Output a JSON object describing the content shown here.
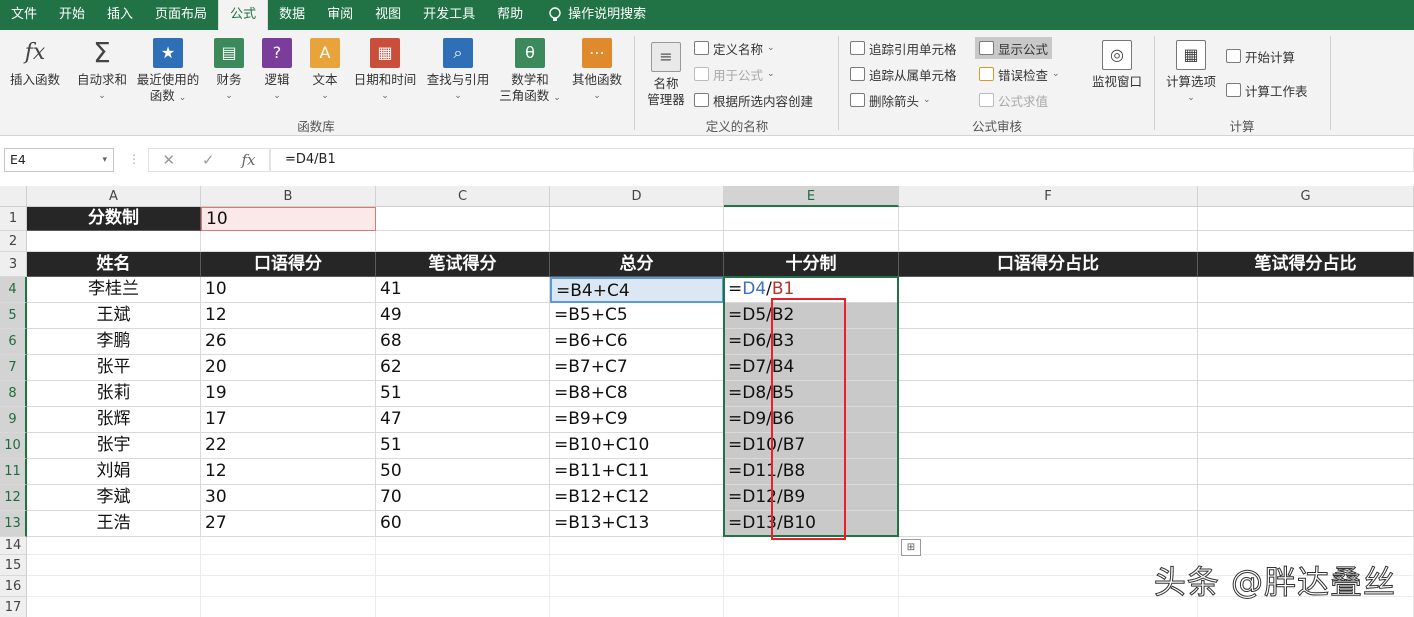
{
  "menu": {
    "tabs": [
      "文件",
      "开始",
      "插入",
      "页面布局",
      "公式",
      "数据",
      "审阅",
      "视图",
      "开发工具",
      "帮助"
    ],
    "active_tab": "公式",
    "tell_me": "操作说明搜索"
  },
  "ribbon": {
    "insert_function": "插入函数",
    "autosum": "自动求和",
    "recent": "最近使用的",
    "recent2": "函数",
    "financial": "财务",
    "logical": "逻辑",
    "text": "文本",
    "datetime": "日期和时间",
    "lookup": "查找与引用",
    "math": "数学和",
    "math2": "三角函数",
    "more": "其他函数",
    "library_label": "函数库",
    "name_manager": "名称",
    "name_manager2": "管理器",
    "define_name": "定义名称",
    "use_in_formula": "用于公式",
    "create_from_selection": "根据所选内容创建",
    "names_label": "定义的名称",
    "trace_precedents": "追踪引用单元格",
    "trace_dependents": "追踪从属单元格",
    "remove_arrows": "删除箭头",
    "show_formulas": "显示公式",
    "error_checking": "错误检查",
    "evaluate_formula": "公式求值",
    "watch_window": "监视窗口",
    "auditing_label": "公式审核",
    "calc_options": "计算选项",
    "calc_now": "开始计算",
    "calc_sheet": "计算工作表",
    "calc_label": "计算"
  },
  "formula_bar": {
    "name_box": "E4",
    "cancel": "✕",
    "enter": "✓",
    "fx": "fx",
    "formula": "=D4/B1"
  },
  "columns": [
    "A",
    "B",
    "C",
    "D",
    "E",
    "F",
    "G"
  ],
  "rows": [
    "1",
    "2",
    "3",
    "4",
    "5",
    "6",
    "7",
    "8",
    "9",
    "10",
    "11",
    "12",
    "13",
    "14",
    "15",
    "16",
    "17"
  ],
  "sheet": {
    "a1": "分数制",
    "b1": "10",
    "headers": [
      "姓名",
      "口语得分",
      "笔试得分",
      "总分",
      "十分制",
      "口语得分占比",
      "笔试得分占比"
    ],
    "data": [
      {
        "name": "李桂兰",
        "oral": "10",
        "written": "41",
        "total": "=B4+C4",
        "tenpt": "=D4/B1"
      },
      {
        "name": "王斌",
        "oral": "12",
        "written": "49",
        "total": "=B5+C5",
        "tenpt": "=D5/B2"
      },
      {
        "name": "李鹏",
        "oral": "26",
        "written": "68",
        "total": "=B6+C6",
        "tenpt": "=D6/B3"
      },
      {
        "name": "张平",
        "oral": "20",
        "written": "62",
        "total": "=B7+C7",
        "tenpt": "=D7/B4"
      },
      {
        "name": "张莉",
        "oral": "19",
        "written": "51",
        "total": "=B8+C8",
        "tenpt": "=D8/B5"
      },
      {
        "name": "张辉",
        "oral": "17",
        "written": "47",
        "total": "=B9+C9",
        "tenpt": "=D9/B6"
      },
      {
        "name": "张宇",
        "oral": "22",
        "written": "51",
        "total": "=B10+C10",
        "tenpt": "=D10/B7"
      },
      {
        "name": "刘娟",
        "oral": "12",
        "written": "50",
        "total": "=B11+C11",
        "tenpt": "=D11/B8"
      },
      {
        "name": "李斌",
        "oral": "30",
        "written": "70",
        "total": "=B12+C12",
        "tenpt": "=D12/B9"
      },
      {
        "name": "王浩",
        "oral": "27",
        "written": "60",
        "total": "=B13+C13",
        "tenpt": "=D13/B10"
      }
    ]
  },
  "e4_parts": {
    "eq": "=",
    "d": "D4",
    "slash": "/",
    "b": "B1"
  },
  "watermark": "头条 @胖达叠丝",
  "colors": {
    "excel_green": "#217346",
    "header_black": "#262626",
    "red_box": "#e8202a"
  }
}
